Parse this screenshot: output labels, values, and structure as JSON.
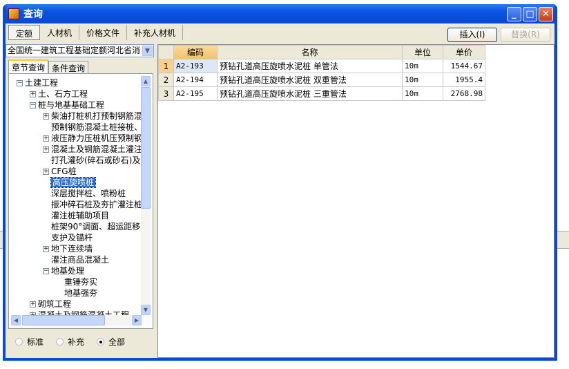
{
  "window": {
    "title": "查询"
  },
  "tabs": [
    "定额",
    "人材机",
    "价格文件",
    "补充人材机"
  ],
  "buttons": {
    "insert": "插入(I)",
    "replace": "替换(R)"
  },
  "library": "全国统一建筑工程基础定额河北省消",
  "subtabs": [
    "章节查询",
    "条件查询"
  ],
  "tree": [
    {
      "label": "土建工程",
      "level": 0,
      "toggle": "minus"
    },
    {
      "label": "土、石方工程",
      "level": 1,
      "toggle": "plus"
    },
    {
      "label": "桩与地基基础工程",
      "level": 1,
      "toggle": "minus"
    },
    {
      "label": "柴油打桩机打预制钢筋混",
      "level": 2,
      "toggle": "plus"
    },
    {
      "label": "预制钢筋混凝土桩接桩、",
      "level": 2,
      "toggle": ""
    },
    {
      "label": "液压静力压桩机压预制钢",
      "level": 2,
      "toggle": "plus"
    },
    {
      "label": "混凝土及钢筋混凝土灌注",
      "level": 2,
      "toggle": "plus"
    },
    {
      "label": "打孔灌砂(碎石或砂石)及",
      "level": 2,
      "toggle": ""
    },
    {
      "label": "CFG桩",
      "level": 2,
      "toggle": "plus"
    },
    {
      "label": "高压旋喷桩",
      "level": 2,
      "toggle": "",
      "selected": true
    },
    {
      "label": "深层搅拌桩、喷粉桩",
      "level": 2,
      "toggle": ""
    },
    {
      "label": "振冲碎石桩及夯扩灌注桩",
      "level": 2,
      "toggle": ""
    },
    {
      "label": "灌注桩辅助项目",
      "level": 2,
      "toggle": ""
    },
    {
      "label": "桩架90°调面、超运距移",
      "level": 2,
      "toggle": ""
    },
    {
      "label": "支护及锚杆",
      "level": 2,
      "toggle": ""
    },
    {
      "label": "地下连续墙",
      "level": 2,
      "toggle": "plus"
    },
    {
      "label": "灌注商品混凝土",
      "level": 2,
      "toggle": ""
    },
    {
      "label": "地基处理",
      "level": 2,
      "toggle": "minus"
    },
    {
      "label": "重锤夯实",
      "level": 3,
      "toggle": ""
    },
    {
      "label": "地基强夯",
      "level": 3,
      "toggle": ""
    },
    {
      "label": "砌筑工程",
      "level": 1,
      "toggle": "plus"
    },
    {
      "label": "混凝土及钢筋混凝土工程",
      "level": 1,
      "toggle": "plus"
    }
  ],
  "filter": {
    "options": [
      "标准",
      "补充",
      "全部"
    ],
    "selected": "全部"
  },
  "table": {
    "columns": [
      "",
      "编码",
      "名称",
      "单位",
      "单价"
    ],
    "rows": [
      {
        "no": "1",
        "code": "A2-193",
        "name": "预钻孔道高压旋喷水泥桩 单管法",
        "unit": "10m",
        "price": "1544.67"
      },
      {
        "no": "2",
        "code": "A2-194",
        "name": "预钻孔道高压旋喷水泥桩 双重管法",
        "unit": "10m",
        "price": "1955.4"
      },
      {
        "no": "3",
        "code": "A2-195",
        "name": "预钻孔道高压旋喷水泥桩 三重管法",
        "unit": "10m",
        "price": "2768.98"
      }
    ]
  }
}
